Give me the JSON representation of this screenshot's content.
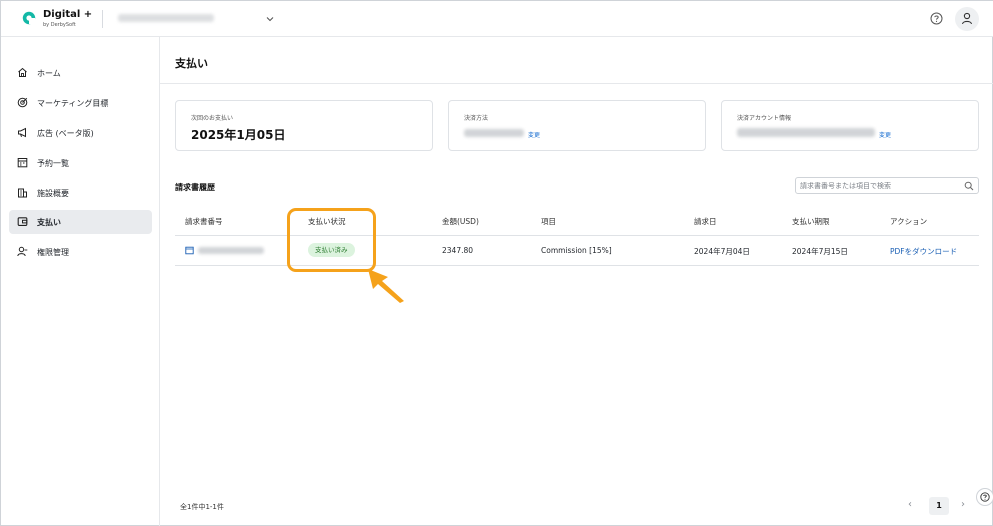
{
  "header": {
    "brand_title": "Digital +",
    "brand_subtitle": "by DerbySoft"
  },
  "sidebar": {
    "items": [
      {
        "label": "ホーム",
        "icon": "home-icon"
      },
      {
        "label": "マーケティング目標",
        "icon": "target-icon"
      },
      {
        "label": "広告 (ベータ版)",
        "icon": "megaphone-icon"
      },
      {
        "label": "予約一覧",
        "icon": "calendar-icon"
      },
      {
        "label": "施設概要",
        "icon": "building-icon"
      },
      {
        "label": "支払い",
        "icon": "wallet-icon",
        "active": true
      },
      {
        "label": "権限管理",
        "icon": "user-permission-icon"
      }
    ]
  },
  "main": {
    "title": "支払い",
    "cards": {
      "next_payment": {
        "label": "次回のお支払い",
        "value": "2025年1月05日"
      },
      "payment_method": {
        "label": "決済方法",
        "change": "変更"
      },
      "payment_account": {
        "label": "決済アカウント情報",
        "change": "変更"
      }
    },
    "invoices": {
      "title": "請求書履歴",
      "search_placeholder": "請求書番号または項目で検索",
      "columns": [
        "請求書番号",
        "支払い状況",
        "金額(USD)",
        "項目",
        "請求日",
        "支払い期限",
        "アクション"
      ],
      "rows": [
        {
          "status": "支払い済み",
          "amount": "2347.80",
          "item": "Commission [15%]",
          "invoice_date": "2024年7月04日",
          "due_date": "2024年7月15日",
          "action": "PDFをダウンロード"
        }
      ]
    },
    "footer": {
      "count": "全1件中1-1件",
      "current_page": "1"
    }
  },
  "colors": {
    "accent_link": "#1a6fd1",
    "status_paid_bg": "#dcf3de",
    "status_paid_text": "#2e7d32",
    "annotation": "#f5a21b",
    "logo": "#13b8a6"
  }
}
